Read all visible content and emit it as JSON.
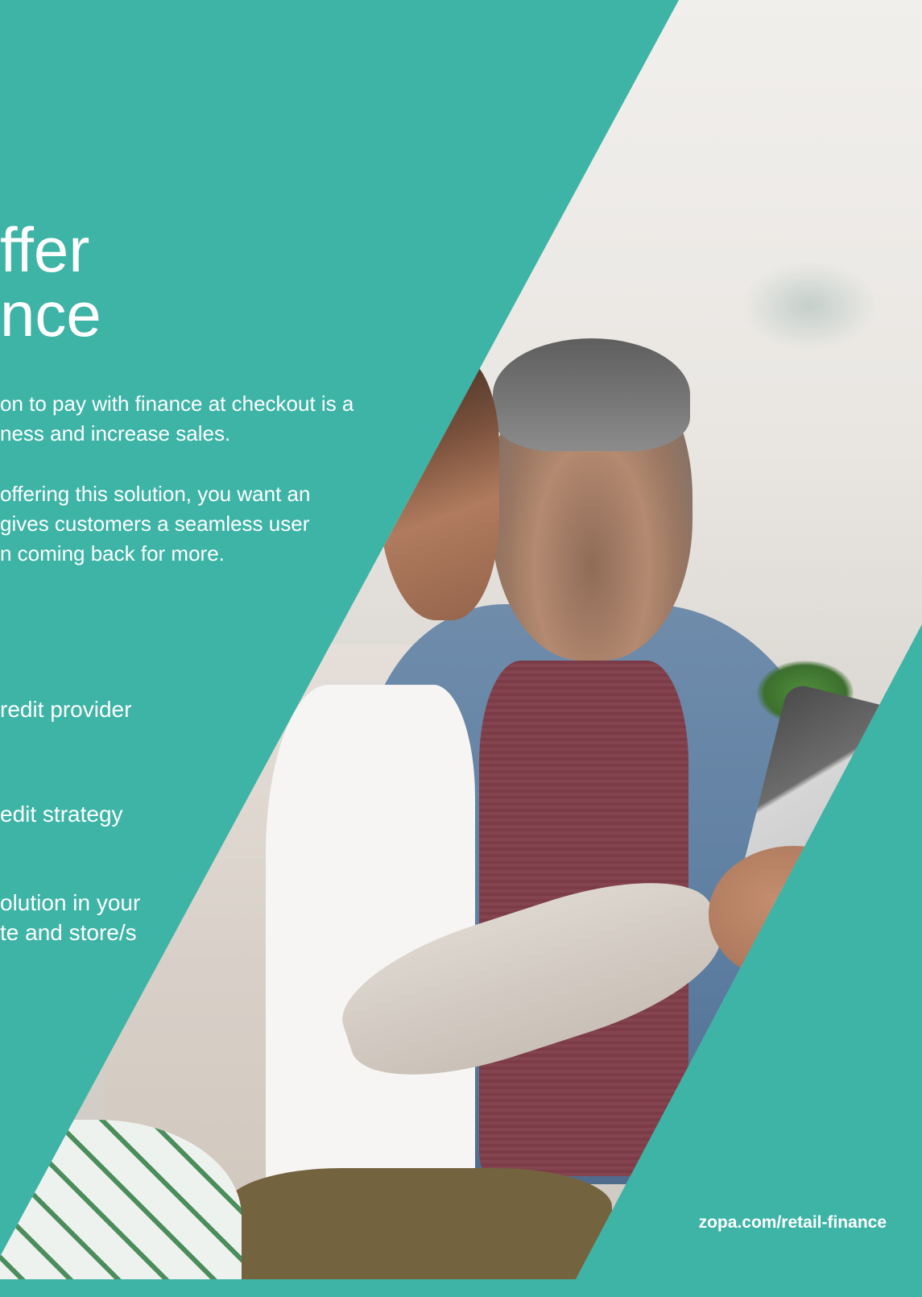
{
  "headline": "ffer\nnce",
  "intro": {
    "paragraph1": "on to pay with finance at checkout is a\nness and increase sales.",
    "paragraph2": "offering this solution, you want an\ngives customers a seamless user\nn coming back for more."
  },
  "list": [
    "redit provider",
    "edit strategy",
    "olution in your\nte and store/s"
  ],
  "footer": {
    "url": "zopa.com/retail-finance"
  },
  "colors": {
    "brand_teal": "#3db4a6",
    "text": "#ffffff"
  }
}
